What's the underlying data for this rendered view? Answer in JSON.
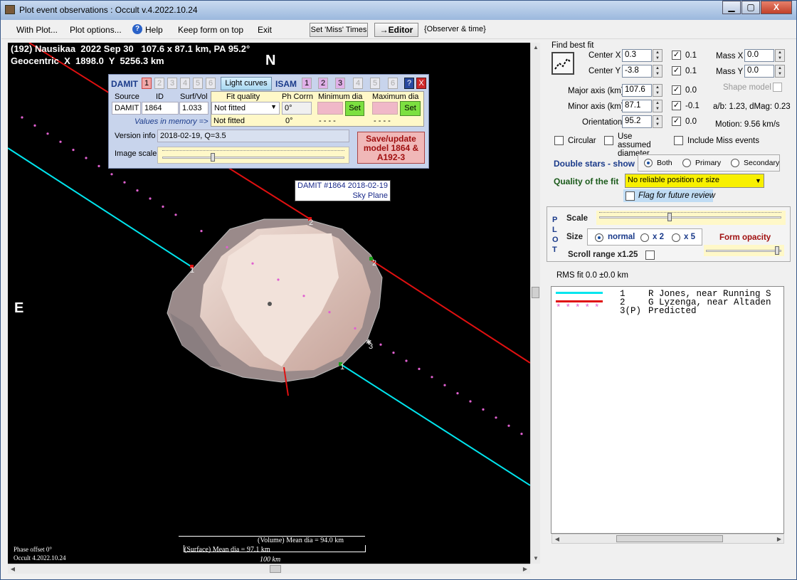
{
  "window": {
    "title": "Plot event observations : Occult v.4.2022.10.24",
    "minimize": "▁",
    "maximize": "▢",
    "close": "X"
  },
  "menu": {
    "items": [
      "With Plot...",
      "Plot options...",
      "Help",
      "Keep form on top",
      "Exit"
    ],
    "set_miss": "Set 'Miss' Times",
    "editor": "→Editor",
    "observer": "{Observer & time}"
  },
  "plot": {
    "header1": "(192) Nausikaa  2022 Sep 30   107.6 x 87.1 km, PA 95.2°",
    "header2": "Geocentric  X  1898.0  Y  5256.3 km",
    "north": "N",
    "east": "E",
    "damit_label1": "DAMIT #1864 2018-02-19",
    "damit_label2": "Sky Plane",
    "chord_labels": [
      "1",
      "2",
      "2",
      "3",
      "1"
    ],
    "mean_vol": "(Volume) Mean dia = 94.0 km",
    "mean_surf": "(Surface) Mean dia = 97.1 km",
    "scale_bar": "100 km",
    "phase": "Phase offset 0°",
    "version": "Occult 4.2022.10.24"
  },
  "damit": {
    "title": "DAMIT",
    "nums": [
      "1",
      "2",
      "3",
      "4",
      "5",
      "6"
    ],
    "light_curves": "Light curves",
    "isam": "ISAM",
    "isam_nums": [
      "1",
      "2",
      "3",
      "4",
      "5",
      "6"
    ],
    "help": "?",
    "close": "X",
    "h_source": "Source",
    "h_id": "ID",
    "h_surf": "Surf/Vol",
    "h_fit": "Fit quality",
    "h_phcorr": "Ph Corrn",
    "h_min": "Minimum dia",
    "h_max": "Maximum dia",
    "source": "DAMIT",
    "id": "1864",
    "surf": "1.033",
    "fit1": "Not fitted",
    "ph1": "0°",
    "fit2": "Not fitted",
    "ph2": "0°",
    "dash1": "- - - -",
    "dash2": "- - - -",
    "set": "Set",
    "memory": "Values in memory =>",
    "version_label": "Version info",
    "version": "2018-02-19, Q=3.5",
    "scale_label": "Image scale",
    "save": "Save/update model  1864 & A192-3"
  },
  "right": {
    "find_best": "Find best fit",
    "center_x_label": "Center X",
    "center_x": "0.3",
    "cx_step": "0.1",
    "center_y_label": "Center Y",
    "center_y": "-3.8",
    "cy_step": "0.1",
    "mass_x_label": "Mass X",
    "mass_x": "0.0",
    "mass_y_label": "Mass Y",
    "mass_y": "0.0",
    "shape_model": "Shape model",
    "major_label": "Major axis (km)",
    "major": "107.6",
    "major_step": "0.0",
    "minor_label": "Minor axis (km)",
    "minor": "87.1",
    "minor_step": "-0.1",
    "orient_label": "Orientation",
    "orient": "95.2",
    "orient_step": "0.0",
    "ab": "a/b: 1.23, dMag: 0.23",
    "motion": "Motion: 9.56 km/s",
    "circular": "Circular",
    "assumed": "Use assumed diameter",
    "miss": "Include Miss events",
    "double_stars": "Double stars - show",
    "both": "Both",
    "primary": "Primary",
    "secondary": "Secondary",
    "quality_label": "Quality of the fit",
    "quality": "No reliable position or size",
    "flag": "Flag for future review",
    "plot_letters": [
      "P",
      "L",
      "O",
      "T"
    ],
    "scale": "Scale",
    "size": "Size",
    "normal": "normal",
    "x2": "x 2",
    "x5": "x 5",
    "form_opacity": "Form opacity",
    "scroll_range": "Scroll range x1.25",
    "rms": "RMS fit 0.0 ±0.0 km"
  },
  "legend": [
    {
      "num": "1",
      "text": "R Jones, near Running S",
      "color": "#00e5ee"
    },
    {
      "num": "2",
      "text": "G Lyzenga, near Altaden",
      "color": "#e01010"
    },
    {
      "num": "3(P)",
      "text": "Predicted",
      "color": "#e060d0"
    }
  ]
}
